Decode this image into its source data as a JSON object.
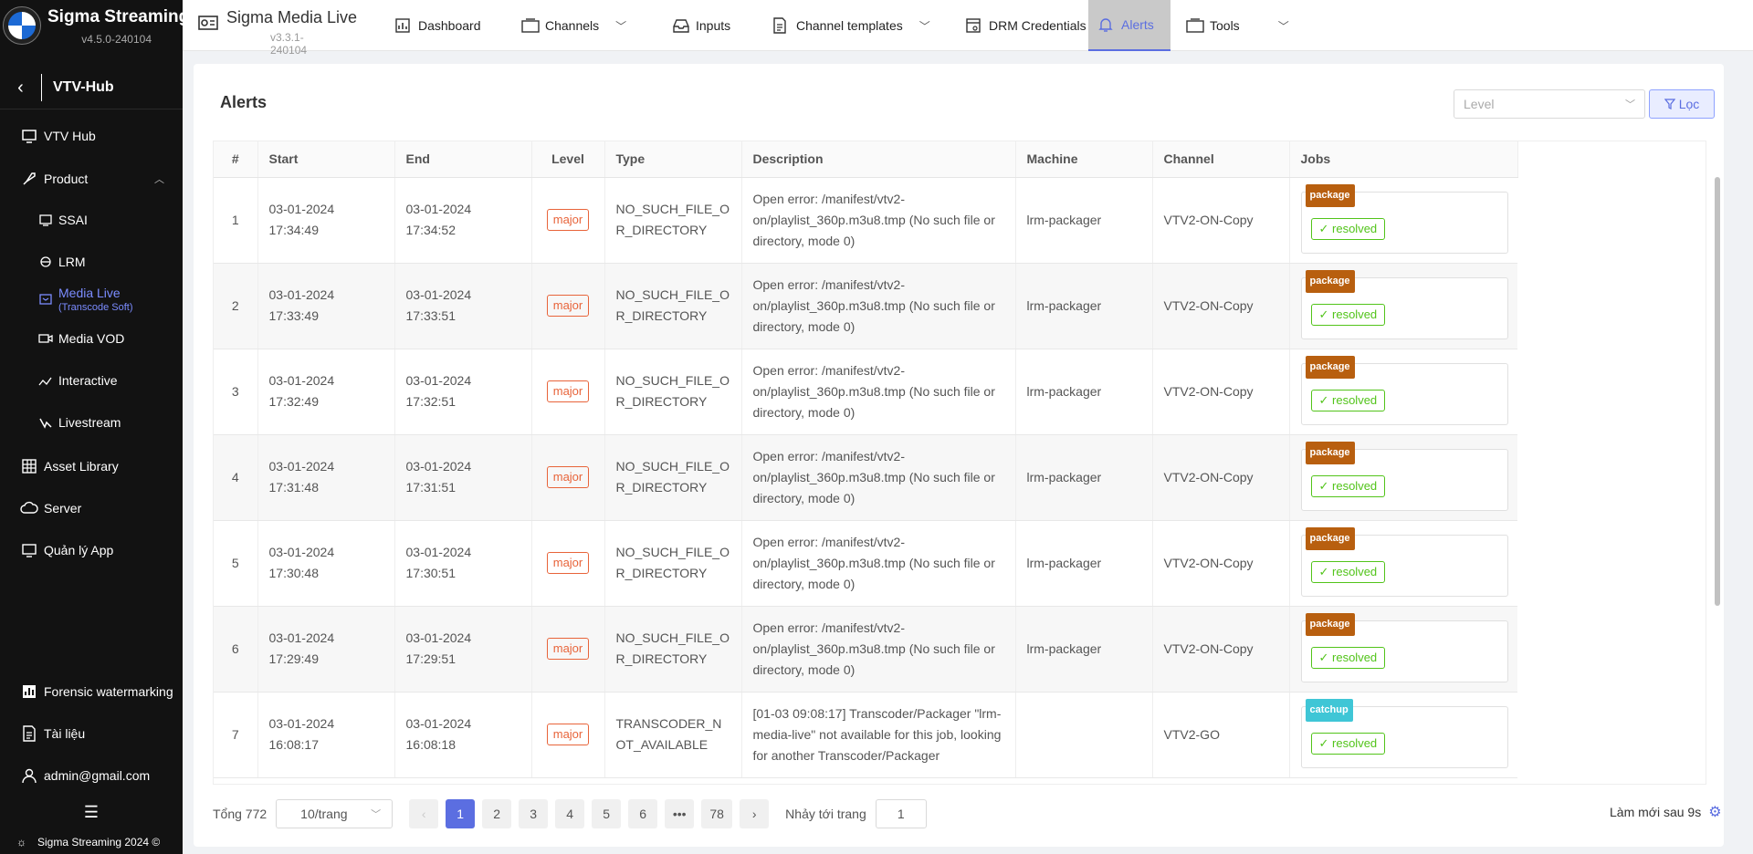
{
  "app": {
    "name": "Sigma Streaming",
    "version": "v4.5.0-240104"
  },
  "hub": {
    "title": "VTV-Hub"
  },
  "sidebar": {
    "items": [
      {
        "label": "VTV Hub"
      },
      {
        "label": "Product"
      },
      {
        "label": "SSAI"
      },
      {
        "label": "LRM"
      },
      {
        "label": "Media Live",
        "sub": "(Transcode Soft)"
      },
      {
        "label": "Media VOD"
      },
      {
        "label": "Interactive"
      },
      {
        "label": "Livestream"
      },
      {
        "label": "Asset Library"
      },
      {
        "label": "Server"
      },
      {
        "label": "Quản lý App"
      }
    ],
    "bottom": [
      {
        "label": "Forensic watermarking"
      },
      {
        "label": "Tài liệu"
      },
      {
        "label": "admin@gmail.com"
      }
    ],
    "copyright": "Sigma Streaming 2024 ©"
  },
  "topbar": {
    "product": "Sigma Media Live",
    "product_version": "v3.3.1-240104",
    "tabs": [
      {
        "label": "Dashboard"
      },
      {
        "label": "Channels"
      },
      {
        "label": "Inputs"
      },
      {
        "label": "Channel templates"
      },
      {
        "label": "DRM Credentials"
      },
      {
        "label": "Alerts"
      },
      {
        "label": "Tools"
      }
    ]
  },
  "page": {
    "title": "Alerts",
    "level_placeholder": "Level",
    "filter_label": "Lọc"
  },
  "table": {
    "headers": [
      "#",
      "Start",
      "End",
      "Level",
      "Type",
      "Description",
      "Machine",
      "Channel",
      "Jobs"
    ],
    "rows": [
      {
        "n": "1",
        "start1": "03-01-2024",
        "start2": "17:34:49",
        "end1": "03-01-2024",
        "end2": "17:34:52",
        "level": "major",
        "type": "NO_SUCH_FILE_OR_DIRECTORY",
        "desc": "Open error: /manifest/vtv2-on/playlist_360p.m3u8.tmp (No such file or directory, mode 0)",
        "machine": "lrm-packager",
        "channel": "VTV2-ON-Copy",
        "job": "package",
        "status": "resolved"
      },
      {
        "n": "2",
        "start1": "03-01-2024",
        "start2": "17:33:49",
        "end1": "03-01-2024",
        "end2": "17:33:51",
        "level": "major",
        "type": "NO_SUCH_FILE_OR_DIRECTORY",
        "desc": "Open error: /manifest/vtv2-on/playlist_360p.m3u8.tmp (No such file or directory, mode 0)",
        "machine": "lrm-packager",
        "channel": "VTV2-ON-Copy",
        "job": "package",
        "status": "resolved"
      },
      {
        "n": "3",
        "start1": "03-01-2024",
        "start2": "17:32:49",
        "end1": "03-01-2024",
        "end2": "17:32:51",
        "level": "major",
        "type": "NO_SUCH_FILE_OR_DIRECTORY",
        "desc": "Open error: /manifest/vtv2-on/playlist_360p.m3u8.tmp (No such file or directory, mode 0)",
        "machine": "lrm-packager",
        "channel": "VTV2-ON-Copy",
        "job": "package",
        "status": "resolved"
      },
      {
        "n": "4",
        "start1": "03-01-2024",
        "start2": "17:31:48",
        "end1": "03-01-2024",
        "end2": "17:31:51",
        "level": "major",
        "type": "NO_SUCH_FILE_OR_DIRECTORY",
        "desc": "Open error: /manifest/vtv2-on/playlist_360p.m3u8.tmp (No such file or directory, mode 0)",
        "machine": "lrm-packager",
        "channel": "VTV2-ON-Copy",
        "job": "package",
        "status": "resolved"
      },
      {
        "n": "5",
        "start1": "03-01-2024",
        "start2": "17:30:48",
        "end1": "03-01-2024",
        "end2": "17:30:51",
        "level": "major",
        "type": "NO_SUCH_FILE_OR_DIRECTORY",
        "desc": "Open error: /manifest/vtv2-on/playlist_360p.m3u8.tmp (No such file or directory, mode 0)",
        "machine": "lrm-packager",
        "channel": "VTV2-ON-Copy",
        "job": "package",
        "status": "resolved"
      },
      {
        "n": "6",
        "start1": "03-01-2024",
        "start2": "17:29:49",
        "end1": "03-01-2024",
        "end2": "17:29:51",
        "level": "major",
        "type": "NO_SUCH_FILE_OR_DIRECTORY",
        "desc": "Open error: /manifest/vtv2-on/playlist_360p.m3u8.tmp (No such file or directory, mode 0)",
        "machine": "lrm-packager",
        "channel": "VTV2-ON-Copy",
        "job": "package",
        "status": "resolved"
      },
      {
        "n": "7",
        "start1": "03-01-2024",
        "start2": "16:08:17",
        "end1": "03-01-2024",
        "end2": "16:08:18",
        "level": "major",
        "type": "TRANSCODER_NOT_AVAILABLE",
        "desc": "[01-03 09:08:17] Transcoder/Packager \"lrm-media-live\" not available for this job, looking for another Transcoder/Packager",
        "machine": "",
        "channel": "VTV2-GO",
        "job": "catchup",
        "status": "resolved"
      }
    ]
  },
  "pagination": {
    "total": "Tổng 772",
    "page_size": "10/trang",
    "pages": [
      "1",
      "2",
      "3",
      "4",
      "5",
      "6",
      "•••",
      "78"
    ],
    "jump_label": "Nhảy tới trang",
    "jump_value": "1"
  },
  "refresh": "Làm mới sau 9s",
  "colors": {
    "accent": "#5b6ee1",
    "major": "#e8643a",
    "resolved": "#52c41a",
    "package": "#b85f0f",
    "catchup": "#3fc6d6"
  }
}
